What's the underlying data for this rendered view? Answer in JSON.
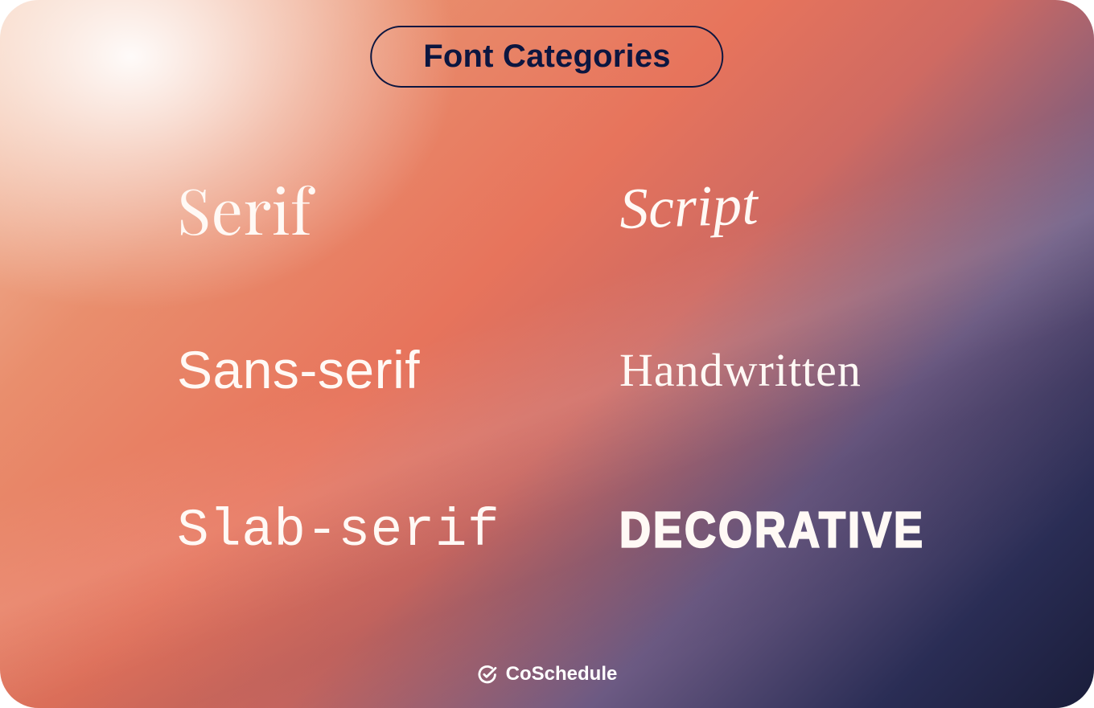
{
  "title": "Font Categories",
  "categories": {
    "serif": "Serif",
    "sans": "Sans-serif",
    "slab": "Slab-serif",
    "script": "Script",
    "hand": "Handwritten",
    "deco": "DECORATIVE"
  },
  "brand": "CoSchedule"
}
